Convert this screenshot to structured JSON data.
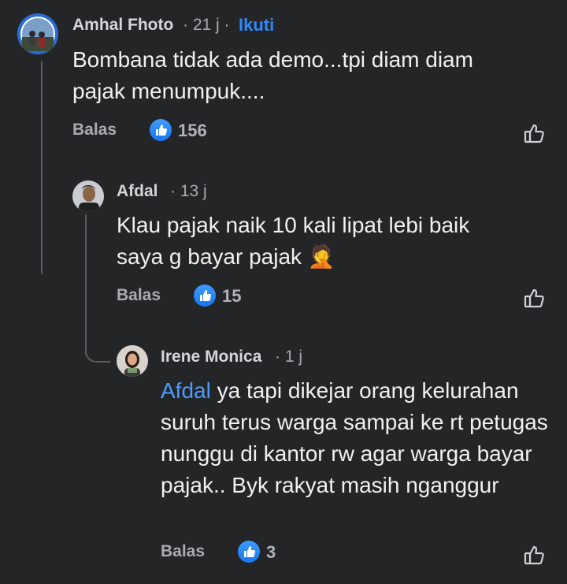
{
  "comments": [
    {
      "author": "Amhal Fhoto",
      "time": "· 21 j ·",
      "follow_label": "Ikuti",
      "text": "Bombana tidak ada demo...tpi diam diam pajak menumpuk....",
      "reply_label": "Balas",
      "likes": "156"
    },
    {
      "author": "Afdal",
      "time": "· 13 j",
      "text": "Klau pajak naik 10 kali lipat lebi baik saya g  bayar pajak 🤦",
      "reply_label": "Balas",
      "likes": "15"
    },
    {
      "author": "Irene Monica",
      "time": "· 1 j",
      "mention": "Afdal",
      "text": " ya  tapi dikejar orang kelurahan suruh terus warga sampai ke rt petugas nunggu di kantor rw agar warga bayar pajak.. Byk rakyat masih nganggur",
      "reply_label": "Balas",
      "likes": "3"
    }
  ],
  "colors": {
    "background": "#242526",
    "accent": "#2d88ff",
    "like_badge": "#1877f2"
  },
  "icons": [
    "avatar",
    "like-badge-icon",
    "thumb-up-outline-icon"
  ]
}
